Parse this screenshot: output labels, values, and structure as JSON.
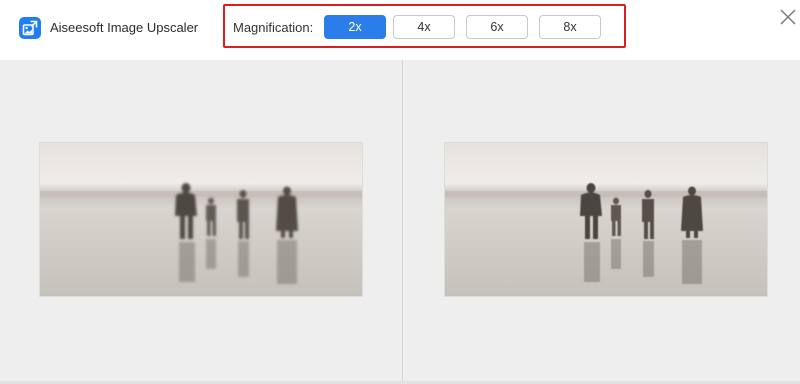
{
  "app": {
    "title": "Aiseesoft Image Upscaler",
    "logo_icon": "image-upscale-icon",
    "accent_color": "#2b7de9"
  },
  "magnification": {
    "label": "Magnification:",
    "options": [
      "2x",
      "4x",
      "6x",
      "8x"
    ],
    "selected": "2x",
    "highlight_color": "#d9201e"
  },
  "window": {
    "close_icon": "close-icon"
  },
  "preview": {
    "left_icon": "original-photo-preview",
    "right_icon": "upscaled-photo-preview"
  }
}
